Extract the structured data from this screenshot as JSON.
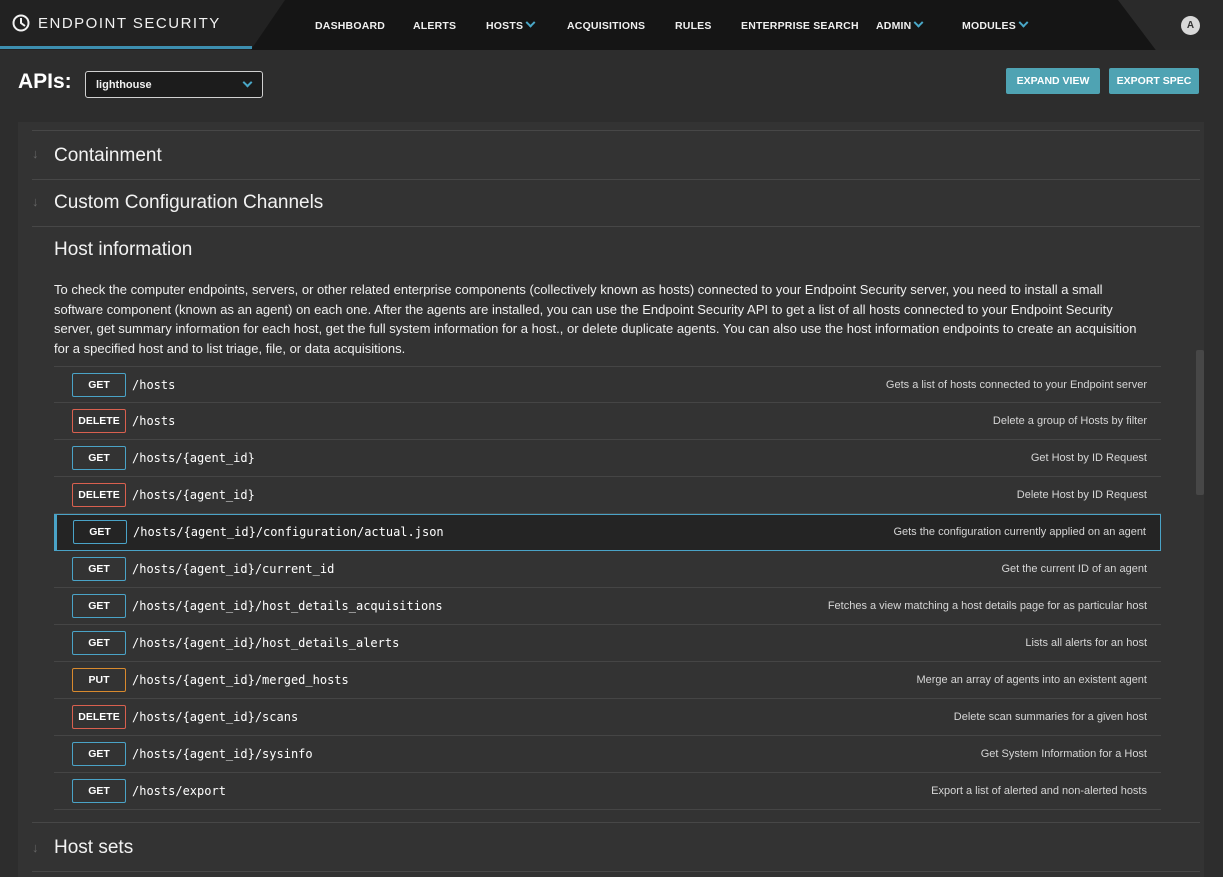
{
  "brand": {
    "name": "ENDPOINT SECURITY",
    "logo_icon": "endpoint-logo-icon"
  },
  "nav": {
    "items": [
      {
        "label": "DASHBOARD",
        "dropdown": false
      },
      {
        "label": "ALERTS",
        "dropdown": false
      },
      {
        "label": "HOSTS",
        "dropdown": true
      },
      {
        "label": "ACQUISITIONS",
        "dropdown": false
      },
      {
        "label": "RULES",
        "dropdown": false
      },
      {
        "label": "ENTERPRISE SEARCH",
        "dropdown": false
      },
      {
        "label": "ADMIN",
        "dropdown": true
      },
      {
        "label": "MODULES",
        "dropdown": true
      }
    ],
    "avatar": "A"
  },
  "header": {
    "apis_label": "APIs:",
    "api_select_value": "lighthouse",
    "expand_label": "EXPAND VIEW",
    "export_label": "EXPORT SPEC"
  },
  "sections": {
    "containment": "Containment",
    "custom_config": "Custom Configuration Channels",
    "host_info": "Host information",
    "host_sets": "Host sets"
  },
  "host_info_description": "To check the computer endpoints, servers, or other related enterprise components (collectively known as hosts) connected to your Endpoint Security server, you need to install a small software component (known as an agent) on each one. After the agents are installed, you can use the Endpoint Security API to get a list of all hosts connected to your Endpoint Security server, get summary information for each host, get the full system information for a host., or delete duplicate agents. You can also use the host information endpoints to create an acquisition for a specified host and to list triage, file, or data acquisitions.",
  "endpoints": [
    {
      "method": "GET",
      "path": "/hosts",
      "summary": "Gets a list of hosts connected to your Endpoint server"
    },
    {
      "method": "DELETE",
      "path": "/hosts",
      "summary": "Delete a group of Hosts by filter"
    },
    {
      "method": "GET",
      "path": "/hosts/{agent_id}",
      "summary": "Get Host by ID Request"
    },
    {
      "method": "DELETE",
      "path": "/hosts/{agent_id}",
      "summary": "Delete Host by ID Request"
    },
    {
      "method": "GET",
      "path": "/hosts/{agent_id}/configuration/actual.json",
      "summary": "Gets the configuration currently applied on an agent",
      "selected": true
    },
    {
      "method": "GET",
      "path": "/hosts/{agent_id}/current_id",
      "summary": "Get the current ID of an agent"
    },
    {
      "method": "GET",
      "path": "/hosts/{agent_id}/host_details_acquisitions",
      "summary": "Fetches a view matching a host details page for as particular host"
    },
    {
      "method": "GET",
      "path": "/hosts/{agent_id}/host_details_alerts",
      "summary": "Lists all alerts for an host"
    },
    {
      "method": "PUT",
      "path": "/hosts/{agent_id}/merged_hosts",
      "summary": "Merge an array of agents into an existent agent"
    },
    {
      "method": "DELETE",
      "path": "/hosts/{agent_id}/scans",
      "summary": "Delete scan summaries for a given host"
    },
    {
      "method": "GET",
      "path": "/hosts/{agent_id}/sysinfo",
      "summary": "Get System Information for a Host"
    },
    {
      "method": "GET",
      "path": "/hosts/export",
      "summary": "Export a list of alerted and non-alerted hosts"
    }
  ],
  "colors": {
    "accent": "#4aa3c7",
    "button": "#4fa3b3",
    "get": "#4aa3c7",
    "delete": "#d9604f",
    "put": "#d98a2e"
  }
}
